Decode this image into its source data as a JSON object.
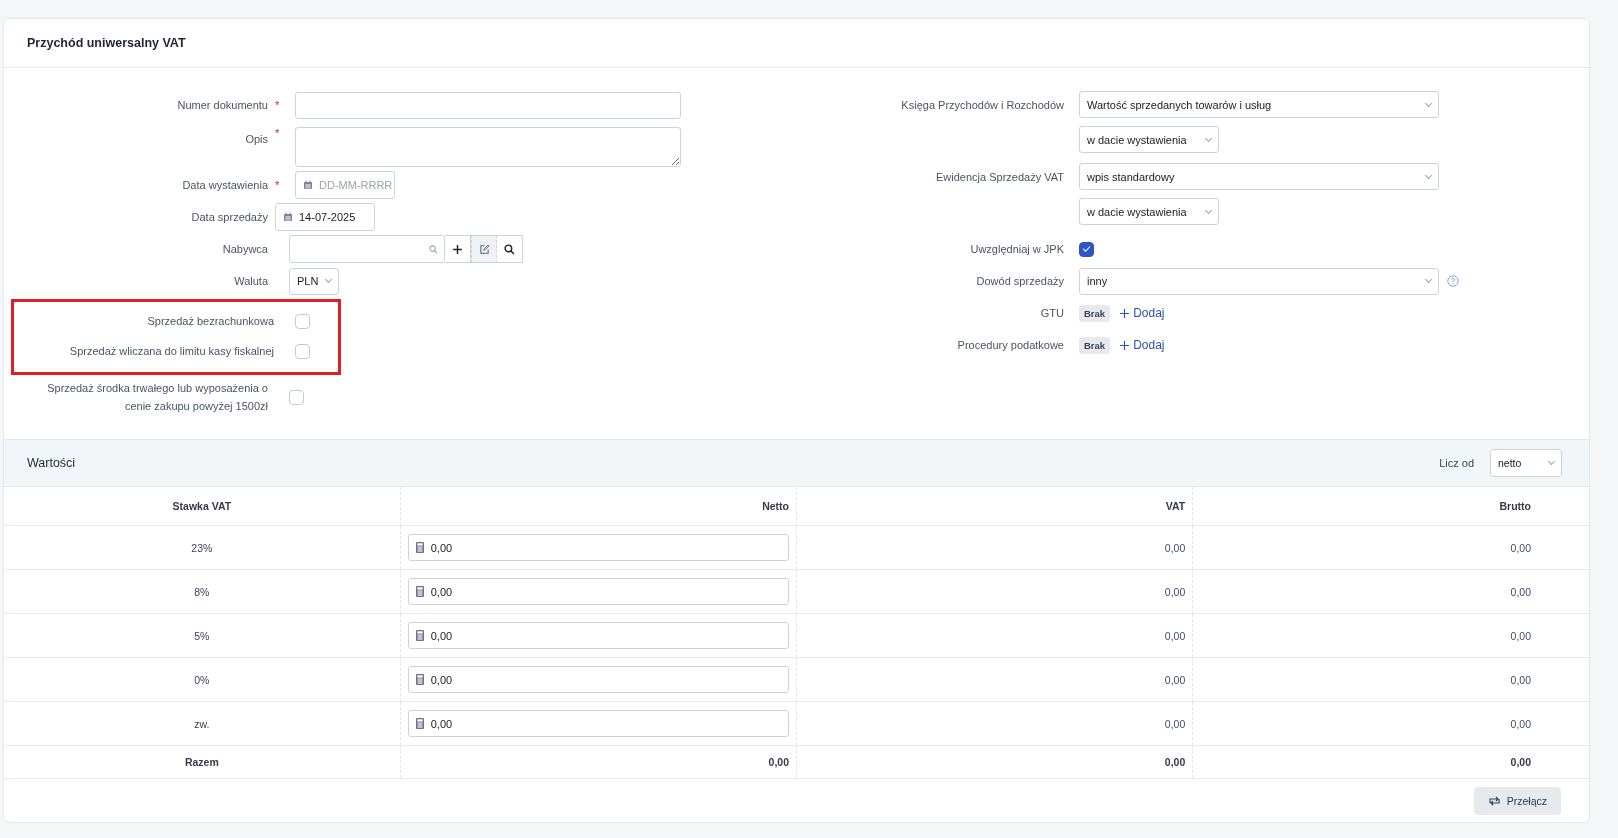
{
  "card_title": "Przychód uniwersalny VAT",
  "left_fields": [
    {
      "kind": "text",
      "label": "Numer dokumentu",
      "required_mark": "*"
    },
    {
      "kind": "textarea",
      "label": "Opis",
      "required_mark": "*"
    },
    {
      "kind": "date",
      "label": "Data wystawienia",
      "required_mark": "*",
      "placeholder": "DD-MM-RRRR"
    },
    {
      "kind": "date",
      "label": "Data sprzedaży",
      "value": "14-07-2025"
    },
    {
      "kind": "lookup",
      "label": "Nabywca"
    },
    {
      "kind": "currency",
      "label": "Waluta",
      "value": "PLN"
    }
  ],
  "highlighted_flags": [
    {
      "label": "Sprzedaż bezrachunkowa",
      "checked": false
    },
    {
      "label": "Sprzedaż wliczana do limitu kasy fiskalnej",
      "checked": false
    }
  ],
  "other_flags": [
    {
      "label": "Sprzedaż środka trwałego lub wyposażenia o cenie zakupu powyżej 1500zł",
      "checked": false
    }
  ],
  "right_fields": [
    {
      "kind": "select_pair",
      "label": "Księga Przychodów i Rozchodów",
      "value": "Wartość sprzedanych towarów i usług",
      "value_2": "w dacie wystawienia"
    },
    {
      "kind": "select_pair",
      "label": "Ewidencja Sprzedaży VAT",
      "value": "wpis standardowy",
      "value_2": "w dacie wystawienia"
    },
    {
      "kind": "checkbox",
      "label": "Uwzględniaj w JPK",
      "checked": true
    },
    {
      "kind": "select_help",
      "label": "Dowód sprzedaży",
      "value": "inny"
    },
    {
      "kind": "tags",
      "label": "GTU",
      "tag": "Brak",
      "action": "Dodaj"
    },
    {
      "kind": "tags",
      "label": "Procedury podatkowe",
      "tag": "Brak",
      "action": "Dodaj"
    }
  ],
  "values_section": {
    "title": "Wartości",
    "calc_label": "Licz od",
    "calc_value": "netto",
    "columns": [
      "Stawka VAT",
      "Netto",
      "VAT",
      "Brutto"
    ],
    "rows": [
      {
        "rate": "23%",
        "netto": "0,00",
        "vat": "0,00",
        "brutto": "0,00"
      },
      {
        "rate": "8%",
        "netto": "0,00",
        "vat": "0,00",
        "brutto": "0,00"
      },
      {
        "rate": "5%",
        "netto": "0,00",
        "vat": "0,00",
        "brutto": "0,00"
      },
      {
        "rate": "0%",
        "netto": "0,00",
        "vat": "0,00",
        "brutto": "0,00"
      },
      {
        "rate": "zw.",
        "netto": "0,00",
        "vat": "0,00",
        "brutto": "0,00"
      }
    ],
    "total": {
      "label": "Razem",
      "netto": "0,00",
      "vat": "0,00",
      "brutto": "0,00"
    },
    "switch_button": "Przełącz"
  }
}
